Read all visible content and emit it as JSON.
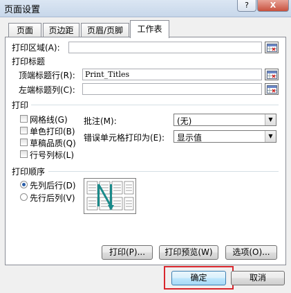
{
  "window": {
    "title": "页面设置",
    "help": "?",
    "close": "X"
  },
  "tabs": [
    {
      "label": "页面"
    },
    {
      "label": "页边距"
    },
    {
      "label": "页眉/页脚"
    },
    {
      "label": "工作表",
      "active": true
    }
  ],
  "print_area": {
    "label": "打印区域(A):",
    "value": ""
  },
  "print_titles": {
    "heading": "打印标题",
    "rows_label": "顶端标题行(R):",
    "rows_value": "Print_Titles",
    "cols_label": "左端标题列(C):",
    "cols_value": ""
  },
  "print": {
    "heading": "打印",
    "checkboxes": [
      {
        "label": "网格线(G)",
        "checked": false
      },
      {
        "label": "单色打印(B)",
        "checked": false
      },
      {
        "label": "草稿品质(Q)",
        "checked": false
      },
      {
        "label": "行号列标(L)",
        "checked": false
      }
    ],
    "comments_label": "批注(M):",
    "comments_value": "(无)",
    "errors_label": "错误单元格打印为(E):",
    "errors_value": "显示值"
  },
  "print_order": {
    "heading": "打印顺序",
    "options": [
      {
        "label": "先列后行(D)",
        "selected": true
      },
      {
        "label": "先行后列(V)",
        "selected": false
      }
    ]
  },
  "panel_buttons": {
    "print": "打印(P)...",
    "preview": "打印预览(W)",
    "options": "选项(O)..."
  },
  "footer_buttons": {
    "ok": "确定",
    "cancel": "取消"
  },
  "colors": {
    "highlight": "#d8262c",
    "order_arrow": "#1a8a8a",
    "radio_dot": "#2a5ea8"
  }
}
